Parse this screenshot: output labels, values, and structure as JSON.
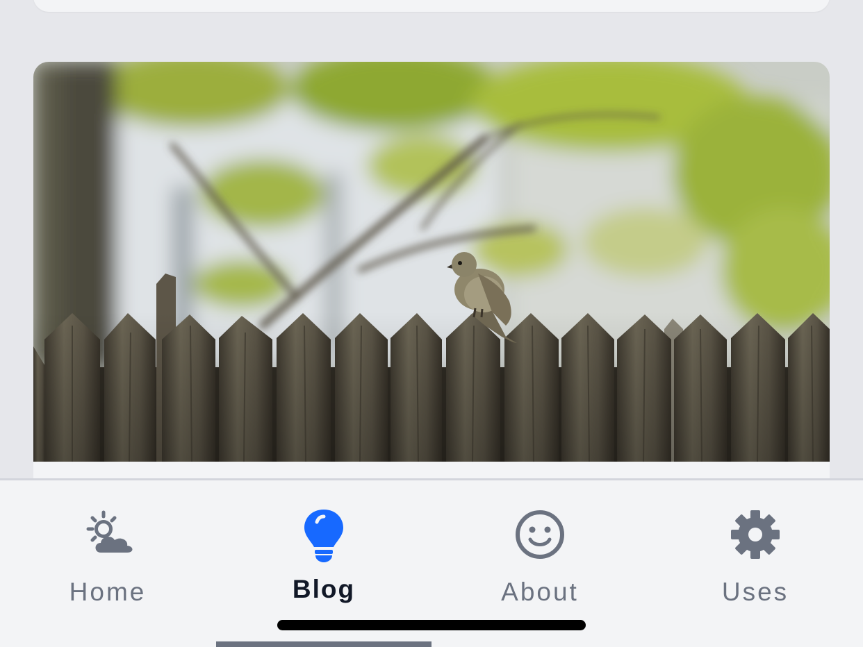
{
  "colors": {
    "page_background": "#e6e7eb",
    "card_background": "#f3f4f6",
    "tab_inactive": "#6b7280",
    "tab_active_label": "#111827",
    "tab_active_icon": "#1769ff"
  },
  "post": {
    "image_subject": "sparrow perched on a weathered wooden picket fence with green tree foliage behind"
  },
  "tabbar": {
    "active_tab": "Blog",
    "tabs": [
      {
        "label": "Home",
        "icon": "partly-cloudy-icon"
      },
      {
        "label": "Blog",
        "icon": "lightbulb-icon"
      },
      {
        "label": "About",
        "icon": "smiley-face-icon"
      },
      {
        "label": "Uses",
        "icon": "gear-icon"
      }
    ]
  }
}
